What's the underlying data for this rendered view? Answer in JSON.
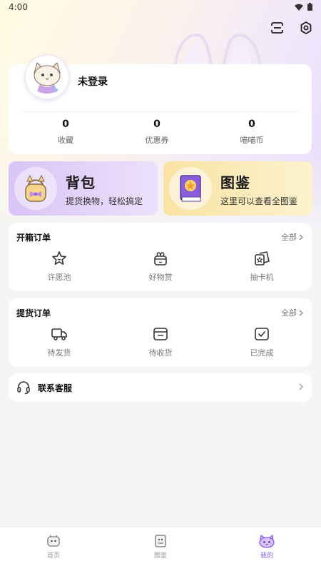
{
  "status_bar": {
    "time": "4:00"
  },
  "profile": {
    "login_text": "未登录",
    "stats": [
      {
        "value": "0",
        "label": "收藏"
      },
      {
        "value": "0",
        "label": "优惠券"
      },
      {
        "value": "0",
        "label": "喵喵币"
      }
    ]
  },
  "promos": {
    "bag": {
      "title": "背包",
      "subtitle": "提货换物，轻松搞定"
    },
    "book": {
      "title": "图鉴",
      "subtitle": "这里可以查看全图鉴"
    }
  },
  "box_orders": {
    "title": "开箱订单",
    "all_label": "全部",
    "items": [
      {
        "label": "许愿池",
        "icon": "star-icon"
      },
      {
        "label": "好物赏",
        "icon": "gift-box-icon"
      },
      {
        "label": "抽卡机",
        "icon": "card-draw-icon"
      }
    ]
  },
  "pickup_orders": {
    "title": "提货订单",
    "all_label": "全部",
    "items": [
      {
        "label": "待发货",
        "icon": "truck-icon"
      },
      {
        "label": "待收货",
        "icon": "package-icon"
      },
      {
        "label": "已完成",
        "icon": "check-square-icon"
      }
    ]
  },
  "service": {
    "label": "联系客服",
    "icon": "headset-icon"
  },
  "tabbar": {
    "tabs": [
      {
        "label": "首页",
        "icon": "home-icon"
      },
      {
        "label": "图鉴",
        "icon": "collection-icon"
      },
      {
        "label": "我的",
        "icon": "cat-face-icon"
      }
    ],
    "active_index": 2
  },
  "colors": {
    "accent": "#8a5cf0",
    "bag_gradient": "#d9c4f6",
    "book_gradient": "#f9e3a3"
  }
}
